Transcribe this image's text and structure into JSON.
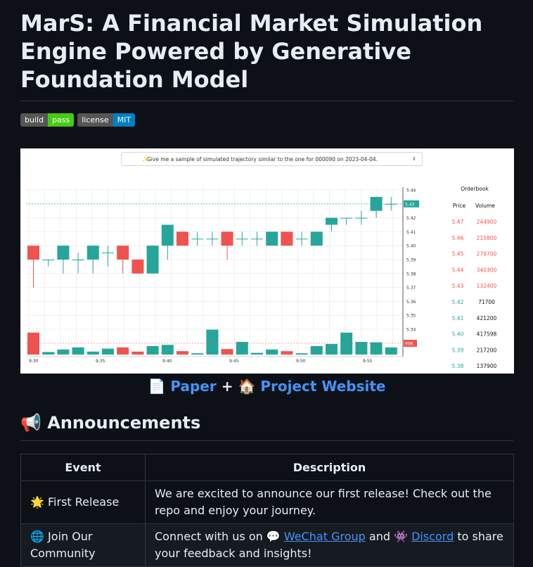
{
  "title": "MarS: A Financial Market Simulation Engine Powered by Generative Foundation Model",
  "badges": [
    {
      "label": "build",
      "value": "pass",
      "color": "#44cc11"
    },
    {
      "label": "license",
      "value": "MIT",
      "color": "#007ec6"
    }
  ],
  "demo": {
    "prompt": "Give me a sample of simulated trajectory similar to the one for 000090 on 2023-04-04.",
    "price_labels": [
      "5.44",
      "5.43",
      "5.42",
      "5.41",
      "5.40",
      "5.39",
      "5.38",
      "5.37",
      "5.36",
      "5.35",
      "5.34"
    ],
    "current_price": "5.43",
    "volume_label": "95K",
    "time_labels": [
      "9:30",
      "9:35",
      "9:40",
      "9:45",
      "9:50",
      "9:55"
    ],
    "orderbook": {
      "title": "Orderbook",
      "price_header": "Price",
      "volume_header": "Volume",
      "rows": [
        {
          "price": "5.47",
          "volume": "244900",
          "side": "ask"
        },
        {
          "price": "5.46",
          "volume": "215800",
          "side": "ask"
        },
        {
          "price": "5.45",
          "volume": "279700",
          "side": "ask"
        },
        {
          "price": "5.44",
          "volume": "340300",
          "side": "ask"
        },
        {
          "price": "5.43",
          "volume": "132400",
          "side": "ask"
        },
        {
          "price": "5.42",
          "volume": "71700",
          "side": "bid"
        },
        {
          "price": "5.41",
          "volume": "421200",
          "side": "bid"
        },
        {
          "price": "5.40",
          "volume": "417598",
          "side": "bid"
        },
        {
          "price": "5.39",
          "volume": "217200",
          "side": "bid"
        },
        {
          "price": "5.38",
          "volume": "137900",
          "side": "bid"
        }
      ]
    },
    "colors": {
      "up": "#26a69a",
      "down": "#ef5350"
    }
  },
  "links": {
    "paper_icon": "📄",
    "paper": "Paper",
    "plus": "+",
    "website_icon": "🏠",
    "website": "Project Website"
  },
  "announcements": {
    "icon": "📢",
    "heading": "Announcements",
    "col_event": "Event",
    "col_description": "Description",
    "rows": [
      {
        "event_icon": "🌟",
        "event": "First Release",
        "description": "We are excited to announce our first release! Check out the repo and enjoy your journey."
      },
      {
        "event_icon": "🌐",
        "event": "Join Our Community",
        "desc_prefix": "Connect with us on",
        "wechat_icon": "💬",
        "wechat": "WeChat Group",
        "and": "and",
        "discord_icon": "👾",
        "discord": "Discord",
        "desc_suffix": "to share your feedback and insights!"
      }
    ]
  }
}
